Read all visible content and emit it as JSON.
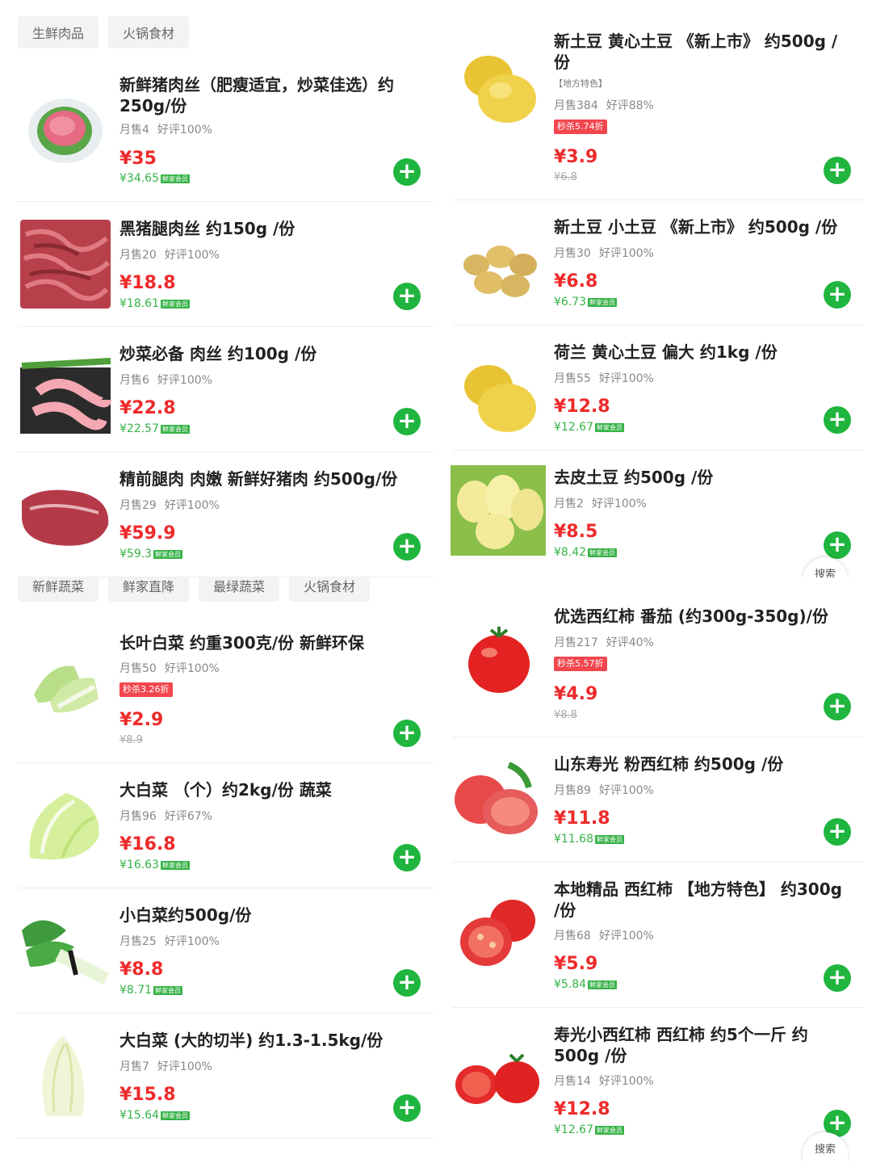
{
  "meat_panel": {
    "tabs": [
      "生鲜肉品",
      "火锅食材"
    ],
    "items": [
      {
        "title": "新鲜猪肉丝（肥瘦适宜，炒菜佳选）约250g/份",
        "sales": "月售4",
        "rating": "好评100%",
        "price": "¥35",
        "member_price": "¥34.65",
        "member_label": "鲜家会员",
        "image": "pork-shreds-image"
      },
      {
        "title": "黑猪腿肉丝 约150g /份",
        "sales": "月售20",
        "rating": "好评100%",
        "price": "¥18.8",
        "member_price": "¥18.61",
        "member_label": "鲜家会员",
        "image": "black-pork-image"
      },
      {
        "title": "炒菜必备 肉丝 约100g /份",
        "sales": "月售6",
        "rating": "好评100%",
        "price": "¥22.8",
        "member_price": "¥22.57",
        "member_label": "鲜家会员",
        "image": "pork-strips-image"
      },
      {
        "title": "精前腿肉 肉嫩 新鲜好猪肉 约500g/份",
        "sales": "月售29",
        "rating": "好评100%",
        "price": "¥59.9",
        "member_price": "¥59.3",
        "member_label": "鲜家会员",
        "image": "front-leg-pork-image"
      }
    ]
  },
  "potato_panel": {
    "items": [
      {
        "title": "新土豆 黄心土豆 《新上市》 约500g /份",
        "tag": "【地方特色】",
        "sales": "月售384",
        "rating": "好评88%",
        "flash": "秒杀5.74折",
        "price": "¥3.9",
        "orig_price": "¥6.8"
      },
      {
        "title": "新土豆 小土豆 《新上市》 约500g /份",
        "sales": "月售30",
        "rating": "好评100%",
        "price": "¥6.8",
        "member_price": "¥6.73",
        "member_label": "鲜家会员"
      },
      {
        "title": "荷兰 黄心土豆 偏大 约1kg /份",
        "sales": "月售55",
        "rating": "好评100%",
        "price": "¥12.8",
        "member_price": "¥12.67",
        "member_label": "鲜家会员"
      },
      {
        "title": "去皮土豆 约500g /份",
        "sales": "月售2",
        "rating": "好评100%",
        "price": "¥8.5",
        "member_price": "¥8.42",
        "member_label": "鲜家会员"
      }
    ],
    "search_label": "搜索"
  },
  "cabbage_panel": {
    "tabs": [
      "新鲜蔬菜",
      "鲜家直降",
      "最绿蔬菜",
      "火锅食材"
    ],
    "items": [
      {
        "title": "长叶白菜 约重300克/份 新鲜环保",
        "sales": "月售50",
        "rating": "好评100%",
        "flash": "秒杀3.26折",
        "price": "¥2.9",
        "orig_price": "¥8.9"
      },
      {
        "title": "大白菜 （个）约2kg/份 蔬菜",
        "sales": "月售96",
        "rating": "好评67%",
        "price": "¥16.8",
        "member_price": "¥16.63",
        "member_label": "鲜家会员"
      },
      {
        "title": "小白菜约500g/份",
        "sales": "月售25",
        "rating": "好评100%",
        "price": "¥8.8",
        "member_price": "¥8.71",
        "member_label": "鲜家会员"
      },
      {
        "title": "大白菜 (大的切半) 约1.3-1.5kg/份",
        "sales": "月售7",
        "rating": "好评100%",
        "price": "¥15.8",
        "member_price": "¥15.64",
        "member_label": "鲜家会员"
      }
    ]
  },
  "tomato_panel": {
    "items": [
      {
        "title": "优选西红柿 番茄 (约300g-350g)/份",
        "sales": "月售217",
        "rating": "好评40%",
        "flash": "秒杀5.57折",
        "price": "¥4.9",
        "orig_price": "¥8.8"
      },
      {
        "title": "山东寿光 粉西红柿 约500g /份",
        "sales": "月售89",
        "rating": "好评100%",
        "price": "¥11.8",
        "member_price": "¥11.68",
        "member_label": "鲜家会员"
      },
      {
        "title": "本地精品 西红柿 【地方特色】 约300g /份",
        "sales": "月售68",
        "rating": "好评100%",
        "price": "¥5.9",
        "member_price": "¥5.84",
        "member_label": "鲜家会员"
      },
      {
        "title": "寿光小西红柿 西红柿 约5个一斤 约500g /份",
        "sales": "月售14",
        "rating": "好评100%",
        "price": "¥12.8",
        "member_price": "¥12.67",
        "member_label": "鲜家会员"
      }
    ],
    "search_label": "搜索"
  },
  "colors": {
    "price_red": "#ee2a2a",
    "add_green": "#1fb53e",
    "member_green": "#36b247",
    "flash_red": "#f2464e"
  }
}
